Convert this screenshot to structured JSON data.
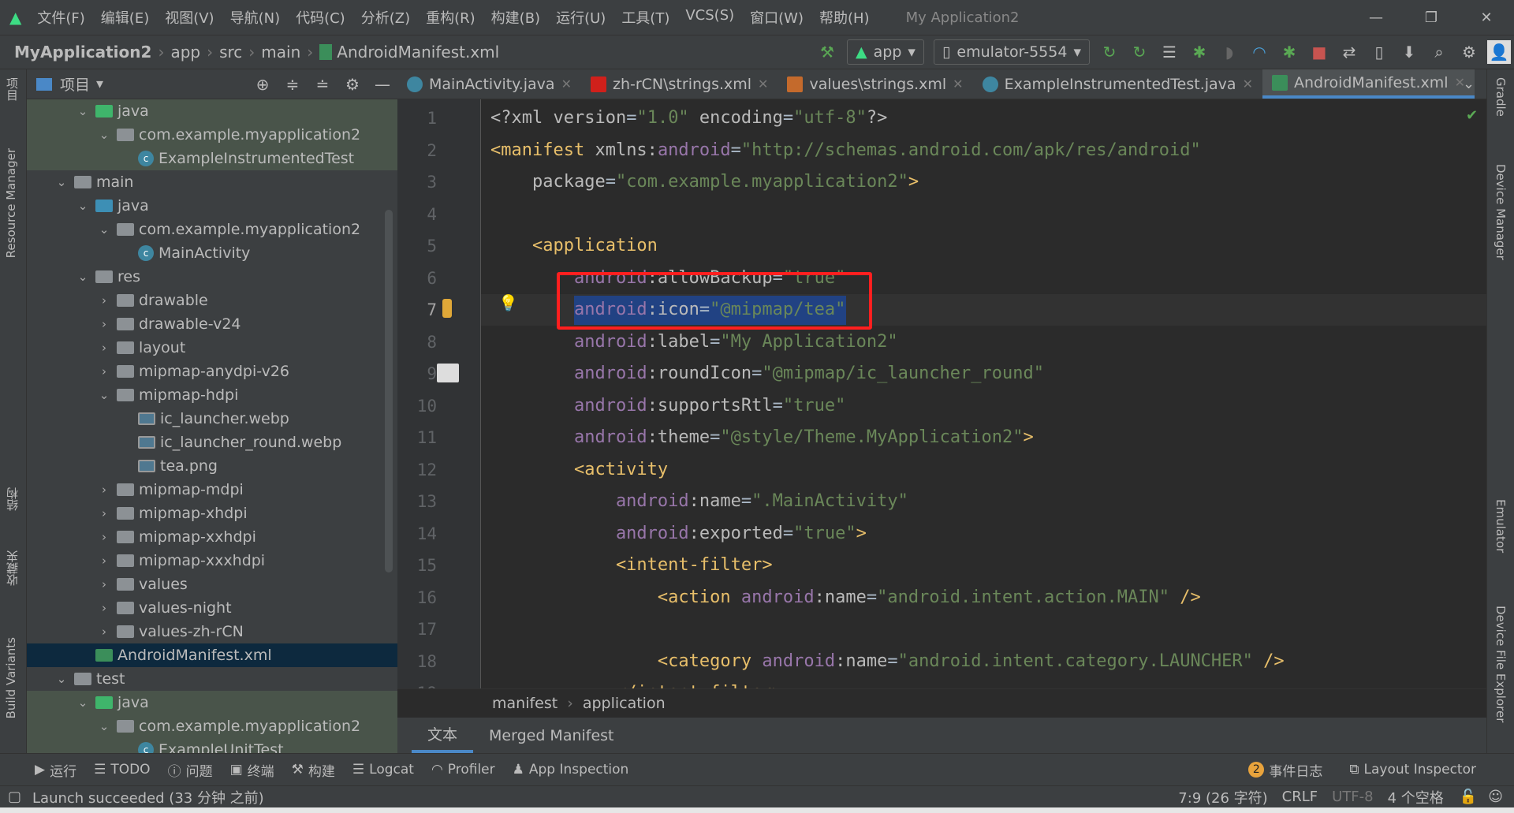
{
  "menubar": {
    "items": [
      "文件(F)",
      "编辑(E)",
      "视图(V)",
      "导航(N)",
      "代码(C)",
      "分析(Z)",
      "重构(R)",
      "构建(B)",
      "运行(U)",
      "工具(T)",
      "VCS(S)",
      "窗口(W)",
      "帮助(H)"
    ],
    "title": "My Application2"
  },
  "navbar": {
    "crumbs": [
      "MyApplication2",
      "app",
      "src",
      "main",
      "AndroidManifest.xml"
    ],
    "run_config": "app",
    "device": "emulator-5554"
  },
  "left_strip": {
    "project": "项目",
    "resource_manager": "Resource Manager",
    "structure": "结构",
    "favorites": "收藏夹",
    "build_variants": "Build Variants"
  },
  "right_strip": {
    "gradle": "Gradle",
    "device_manager": "Device Manager",
    "emulator": "Emulator",
    "device_file_explorer": "Device File Explorer"
  },
  "project": {
    "title": "项目",
    "tree": [
      {
        "level": 3,
        "arrow": "open",
        "icon": "folder-green",
        "label": "java",
        "bg": "green"
      },
      {
        "level": 4,
        "arrow": "open",
        "icon": "package",
        "label": "com.example.myapplication2",
        "bg": "green"
      },
      {
        "level": 5,
        "arrow": "",
        "icon": "class",
        "label": "ExampleInstrumentedTest",
        "bg": "green"
      },
      {
        "level": 2,
        "arrow": "open",
        "icon": "folder",
        "label": "main",
        "bg": ""
      },
      {
        "level": 3,
        "arrow": "open",
        "icon": "folder-blue",
        "label": "java",
        "bg": ""
      },
      {
        "level": 4,
        "arrow": "open",
        "icon": "package",
        "label": "com.example.myapplication2",
        "bg": ""
      },
      {
        "level": 5,
        "arrow": "",
        "icon": "class",
        "label": "MainActivity",
        "bg": ""
      },
      {
        "level": 3,
        "arrow": "open",
        "icon": "folder-res",
        "label": "res",
        "bg": ""
      },
      {
        "level": 4,
        "arrow": "closed",
        "icon": "folder",
        "label": "drawable",
        "bg": ""
      },
      {
        "level": 4,
        "arrow": "closed",
        "icon": "folder",
        "label": "drawable-v24",
        "bg": ""
      },
      {
        "level": 4,
        "arrow": "closed",
        "icon": "folder",
        "label": "layout",
        "bg": ""
      },
      {
        "level": 4,
        "arrow": "closed",
        "icon": "folder",
        "label": "mipmap-anydpi-v26",
        "bg": ""
      },
      {
        "level": 4,
        "arrow": "open",
        "icon": "folder",
        "label": "mipmap-hdpi",
        "bg": ""
      },
      {
        "level": 5,
        "arrow": "",
        "icon": "image",
        "label": "ic_launcher.webp",
        "bg": ""
      },
      {
        "level": 5,
        "arrow": "",
        "icon": "image",
        "label": "ic_launcher_round.webp",
        "bg": ""
      },
      {
        "level": 5,
        "arrow": "",
        "icon": "image",
        "label": "tea.png",
        "bg": ""
      },
      {
        "level": 4,
        "arrow": "closed",
        "icon": "folder",
        "label": "mipmap-mdpi",
        "bg": ""
      },
      {
        "level": 4,
        "arrow": "closed",
        "icon": "folder",
        "label": "mipmap-xhdpi",
        "bg": ""
      },
      {
        "level": 4,
        "arrow": "closed",
        "icon": "folder",
        "label": "mipmap-xxhdpi",
        "bg": ""
      },
      {
        "level": 4,
        "arrow": "closed",
        "icon": "folder",
        "label": "mipmap-xxxhdpi",
        "bg": ""
      },
      {
        "level": 4,
        "arrow": "closed",
        "icon": "folder",
        "label": "values",
        "bg": ""
      },
      {
        "level": 4,
        "arrow": "closed",
        "icon": "folder",
        "label": "values-night",
        "bg": ""
      },
      {
        "level": 4,
        "arrow": "closed",
        "icon": "folder",
        "label": "values-zh-rCN",
        "bg": ""
      },
      {
        "level": 3,
        "arrow": "",
        "icon": "manifest",
        "label": "AndroidManifest.xml",
        "bg": "selected"
      },
      {
        "level": 2,
        "arrow": "open",
        "icon": "folder",
        "label": "test",
        "bg": ""
      },
      {
        "level": 3,
        "arrow": "open",
        "icon": "folder-green",
        "label": "java",
        "bg": "green"
      },
      {
        "level": 4,
        "arrow": "open",
        "icon": "package",
        "label": "com.example.myapplication2",
        "bg": "green"
      },
      {
        "level": 5,
        "arrow": "",
        "icon": "class",
        "label": "ExampleUnitTest",
        "bg": "green"
      }
    ]
  },
  "tabs": [
    {
      "label": "MainActivity.java",
      "icon": "class",
      "active": false
    },
    {
      "label": "zh-rCN\\strings.xml",
      "icon": "flag-cn",
      "active": false
    },
    {
      "label": "values\\strings.xml",
      "icon": "xml",
      "active": false
    },
    {
      "label": "ExampleInstrumentedTest.java",
      "icon": "class",
      "active": false
    },
    {
      "label": "AndroidManifest.xml",
      "icon": "manifest",
      "active": true
    }
  ],
  "editor": {
    "current_line": 7,
    "lines": [
      [
        [
          "pi",
          "<?xml "
        ],
        [
          "attr",
          "version"
        ],
        [
          "plain",
          "="
        ],
        [
          "val",
          "\"1.0\""
        ],
        [
          "attr",
          " encoding"
        ],
        [
          "plain",
          "="
        ],
        [
          "val",
          "\"utf-8\""
        ],
        [
          "pi",
          "?>"
        ]
      ],
      [
        [
          "tag",
          "<manifest "
        ],
        [
          "attr",
          "xmlns:"
        ],
        [
          "ns",
          "android"
        ],
        [
          "plain",
          "="
        ],
        [
          "val",
          "\"http://schemas.android.com/apk/res/android\""
        ]
      ],
      [
        [
          "attr",
          "    package"
        ],
        [
          "plain",
          "="
        ],
        [
          "val",
          "\"com.example.myapplication2\""
        ],
        [
          "tag",
          ">"
        ]
      ],
      [],
      [
        [
          "tag",
          "    <application"
        ]
      ],
      [
        [
          "ns",
          "        android"
        ],
        [
          "attr",
          ":allowBackup"
        ],
        [
          "plain",
          "="
        ],
        [
          "val",
          "\"true\""
        ]
      ],
      [
        [
          "ns",
          "        android"
        ],
        [
          "attr",
          ":icon"
        ],
        [
          "plain",
          "="
        ],
        [
          "val",
          "\"@mipmap/tea\""
        ]
      ],
      [
        [
          "ns",
          "        android"
        ],
        [
          "attr",
          ":label"
        ],
        [
          "plain",
          "="
        ],
        [
          "val",
          "\"My Application2\""
        ]
      ],
      [
        [
          "ns",
          "        android"
        ],
        [
          "attr",
          ":roundIcon"
        ],
        [
          "plain",
          "="
        ],
        [
          "val",
          "\"@mipmap/ic_launcher_round\""
        ]
      ],
      [
        [
          "ns",
          "        android"
        ],
        [
          "attr",
          ":supportsRtl"
        ],
        [
          "plain",
          "="
        ],
        [
          "val",
          "\"true\""
        ]
      ],
      [
        [
          "ns",
          "        android"
        ],
        [
          "attr",
          ":theme"
        ],
        [
          "plain",
          "="
        ],
        [
          "val",
          "\"@style/Theme.MyApplication2\""
        ],
        [
          "tag",
          ">"
        ]
      ],
      [
        [
          "tag",
          "        <activity"
        ]
      ],
      [
        [
          "ns",
          "            android"
        ],
        [
          "attr",
          ":name"
        ],
        [
          "plain",
          "="
        ],
        [
          "val",
          "\".MainActivity\""
        ]
      ],
      [
        [
          "ns",
          "            android"
        ],
        [
          "attr",
          ":exported"
        ],
        [
          "plain",
          "="
        ],
        [
          "val",
          "\"true\""
        ],
        [
          "tag",
          ">"
        ]
      ],
      [
        [
          "tag",
          "            <intent-filter>"
        ]
      ],
      [
        [
          "tag",
          "                <action "
        ],
        [
          "ns",
          "android"
        ],
        [
          "attr",
          ":name"
        ],
        [
          "plain",
          "="
        ],
        [
          "val",
          "\"android.intent.action.MAIN\""
        ],
        [
          "tag",
          " />"
        ]
      ],
      [],
      [
        [
          "tag",
          "                <category "
        ],
        [
          "ns",
          "android"
        ],
        [
          "attr",
          ":name"
        ],
        [
          "plain",
          "="
        ],
        [
          "val",
          "\"android.intent.category.LAUNCHER\""
        ],
        [
          "tag",
          " />"
        ]
      ],
      [
        [
          "tag",
          "            </intent-filter>"
        ]
      ]
    ]
  },
  "breadcrumb": [
    "manifest",
    "application"
  ],
  "bottom_tabs": [
    {
      "label": "文本",
      "active": true
    },
    {
      "label": "Merged Manifest",
      "active": false
    }
  ],
  "tool_windows": [
    "运行",
    "TODO",
    "问题",
    "终端",
    "构建",
    "Logcat",
    "Profiler",
    "App Inspection"
  ],
  "tool_windows_right": {
    "event_log": "事件日志",
    "event_count": "2",
    "layout_inspector": "Layout Inspector"
  },
  "status": {
    "message": "Launch succeeded (33 分钟 之前)",
    "position": "7:9 (26 字符)",
    "line_sep": "CRLF",
    "encoding": "UTF-8",
    "indent": "4 个空格"
  },
  "colors": {
    "accent": "#4a88c7",
    "highlight_box": "#ff1f1f",
    "selection": "#214283"
  }
}
